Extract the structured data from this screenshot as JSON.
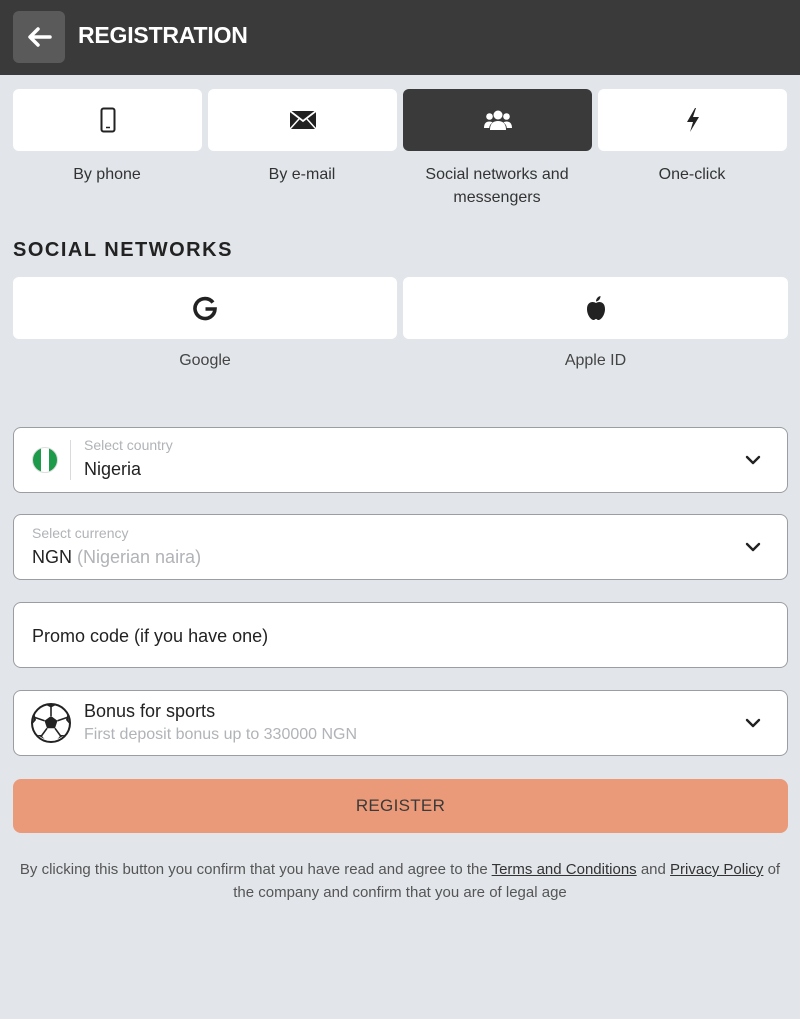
{
  "header": {
    "title": "REGISTRATION",
    "back_icon": "arrow-left-icon"
  },
  "methods": [
    {
      "label": "By phone",
      "icon": "phone-icon",
      "active": false
    },
    {
      "label": "By e-mail",
      "icon": "envelope-icon",
      "active": false
    },
    {
      "label_line1": "Social networks and",
      "label_line2": "messengers",
      "icon": "users-icon",
      "active": true
    },
    {
      "label": "One-click",
      "icon": "lightning-icon",
      "active": false
    }
  ],
  "social": {
    "title": "SOCIAL NETWORKS",
    "buttons": [
      {
        "label": "Google",
        "icon": "google-icon"
      },
      {
        "label": "Apple ID",
        "icon": "apple-icon"
      }
    ]
  },
  "form": {
    "country": {
      "label": "Select country",
      "value": "Nigeria",
      "flag_colors": [
        "#1d9a4a",
        "#ffffff",
        "#1d9a4a"
      ]
    },
    "currency": {
      "label": "Select currency",
      "code": "NGN",
      "name": "(Nigerian naira)"
    },
    "promo": {
      "placeholder": "Promo code (if you have one)"
    },
    "bonus": {
      "title": "Bonus for sports",
      "subtitle": "First deposit bonus up to 330000 NGN",
      "icon": "soccer-ball-icon"
    }
  },
  "register_label": "REGISTER",
  "legal": {
    "prefix": "By clicking this button you confirm that you have read and agree to the ",
    "terms": "Terms and Conditions",
    "and": " and ",
    "privacy": "Privacy Policy",
    "suffix": " of the company and confirm that you are of legal age"
  },
  "colors": {
    "header": "#3a3a3a",
    "accent": "#ea9a78",
    "background": "#e2e6ea"
  }
}
